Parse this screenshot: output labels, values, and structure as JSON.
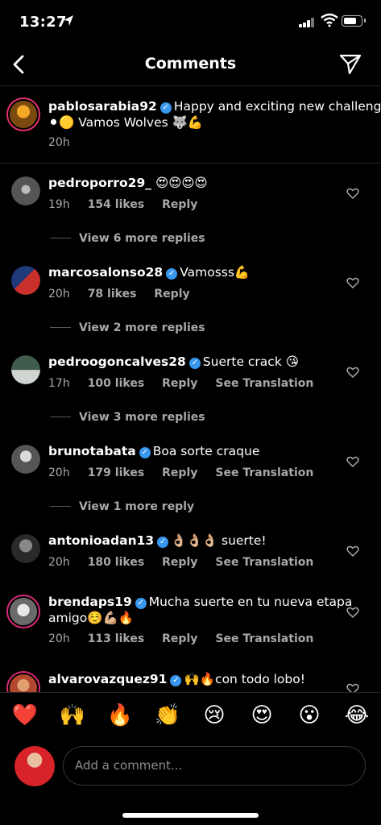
{
  "status": {
    "time": "13:27"
  },
  "header": {
    "title": "Comments"
  },
  "caption": {
    "username": "pablosarabia92",
    "text_line1": "Happy and exciting new challenge",
    "text_line2": "⚫🟡 Vamos Wolves 🐺💪",
    "time": "20h"
  },
  "comments": [
    {
      "username": "pedroporro29_",
      "verified": false,
      "text": "😍😍😍😍",
      "time": "19h",
      "likes": "154 likes",
      "reply": "Reply",
      "translate": "",
      "more": "View 6 more replies",
      "avatar_color": "#555"
    },
    {
      "username": "marcosalonso28",
      "verified": true,
      "text": "Vamosss💪",
      "time": "20h",
      "likes": "78 likes",
      "reply": "Reply",
      "translate": "",
      "more": "View 2 more replies",
      "avatar_color": "#2a4c8c"
    },
    {
      "username": "pedroogoncalves28",
      "verified": true,
      "text": "Suerte crack 😘",
      "time": "17h",
      "likes": "100 likes",
      "reply": "Reply",
      "translate": "See Translation",
      "more": "View 3 more replies",
      "avatar_color": "#3a5a4a"
    },
    {
      "username": "brunotabata",
      "verified": true,
      "text": "Boa sorte craque",
      "time": "20h",
      "likes": "179 likes",
      "reply": "Reply",
      "translate": "See Translation",
      "more": "View 1 more reply",
      "avatar_color": "#777"
    },
    {
      "username": "antonioadan13",
      "verified": true,
      "text": "👌🏼👌🏼👌🏼 suerte!",
      "time": "20h",
      "likes": "180 likes",
      "reply": "Reply",
      "translate": "See Translation",
      "more": "",
      "avatar_color": "#333"
    },
    {
      "username": "brendaps19",
      "verified": true,
      "text_line1": "Mucha suerte en tu nueva etapa",
      "text_line2": "amigo☺️💪🏼🔥",
      "time": "20h",
      "likes": "113 likes",
      "reply": "Reply",
      "translate": "See Translation",
      "more": "",
      "avatar_color": "#aaa"
    },
    {
      "username": "alvarovazquez91",
      "verified": true,
      "text": "🙌🔥con todo lobo!",
      "avatar_color": "#b4482f"
    }
  ],
  "reactions": [
    "❤️",
    "🙌",
    "🔥",
    "👏",
    "😢",
    "😍",
    "😮",
    "😂"
  ],
  "composer": {
    "placeholder": "Add a comment..."
  }
}
